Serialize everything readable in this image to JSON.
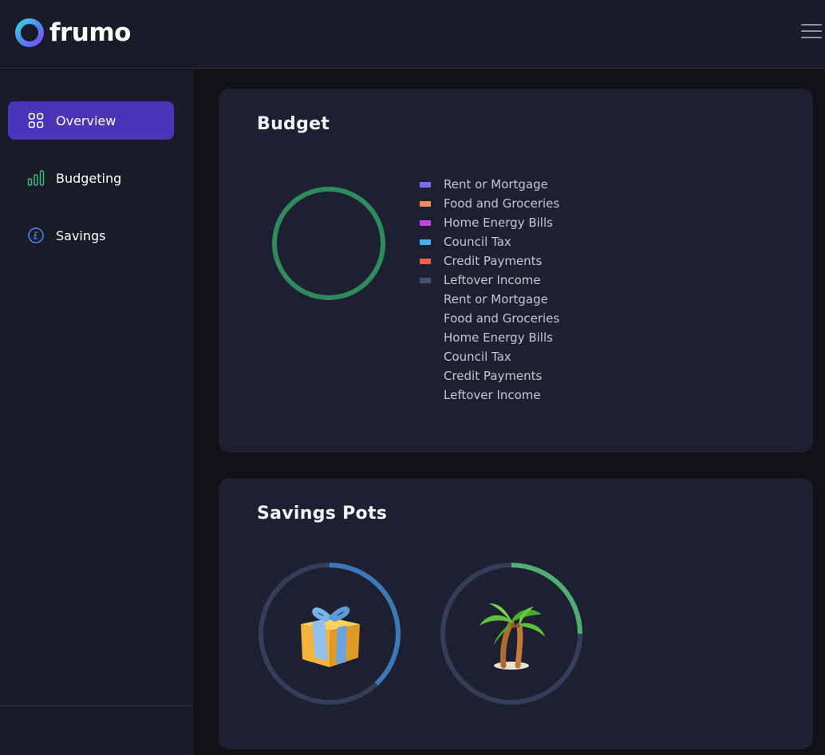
{
  "app": {
    "brand": "frumo"
  },
  "header": {
    "menu_icon": "hamburger-menu-icon"
  },
  "sidebar": {
    "items": [
      {
        "label": "Overview",
        "icon": "grid-icon",
        "active": true
      },
      {
        "label": "Budgeting",
        "icon": "bar-chart-icon",
        "active": false
      },
      {
        "label": "Savings",
        "icon": "pound-coin-icon",
        "active": false
      }
    ]
  },
  "budget": {
    "title": "Budget",
    "legend": [
      {
        "label": "Rent or Mortgage",
        "color": "#7b6cf2"
      },
      {
        "label": "Food and Groceries",
        "color": "#f08a5d"
      },
      {
        "label": "Home Energy Bills",
        "color": "#c441e8"
      },
      {
        "label": "Council Tax",
        "color": "#3fb0f2"
      },
      {
        "label": "Credit Payments",
        "color": "#ef6049"
      },
      {
        "label": "Leftover Income",
        "color": "#465073"
      },
      {
        "label": "Rent or Mortgage",
        "color": null
      },
      {
        "label": "Food and Groceries",
        "color": null
      },
      {
        "label": "Home Energy Bills",
        "color": null
      },
      {
        "label": "Council Tax",
        "color": null
      },
      {
        "label": "Credit Payments",
        "color": null
      },
      {
        "label": "Leftover Income",
        "color": null
      }
    ],
    "ring_color": "#2f8a5d"
  },
  "savings": {
    "title": "Savings Pots",
    "pots": [
      {
        "icon": "gift-icon",
        "progress": 0.38,
        "color": "#3a78b8"
      },
      {
        "icon": "palm-tree-icon",
        "progress": 0.25,
        "color": "#4fae72"
      }
    ],
    "track_color": "#363d58"
  }
}
